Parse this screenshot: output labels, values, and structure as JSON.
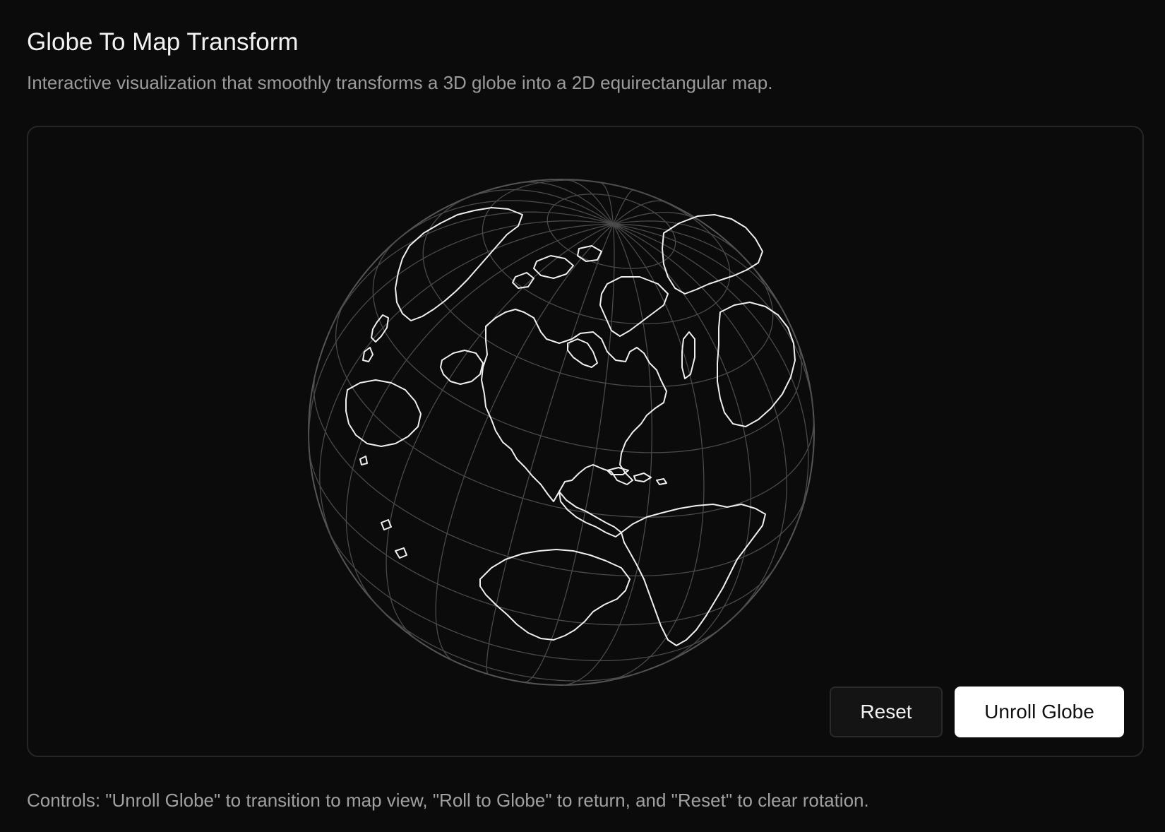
{
  "header": {
    "title": "Globe To Map Transform",
    "subtitle": "Interactive visualization that smoothly transforms a 3D globe into a 2D equirectangular map."
  },
  "visualization": {
    "view": "globe",
    "projection": "orthographic",
    "graticule_color": "#4a4a4a",
    "land_outline_color": "#f0f0f0",
    "background_color": "#0b0b0b"
  },
  "controls": {
    "reset_label": "Reset",
    "unroll_label": "Unroll Globe"
  },
  "footer": {
    "note": "Controls: \"Unroll Globe\" to transition to map view, \"Roll to Globe\" to return, and \"Reset\" to clear rotation."
  }
}
